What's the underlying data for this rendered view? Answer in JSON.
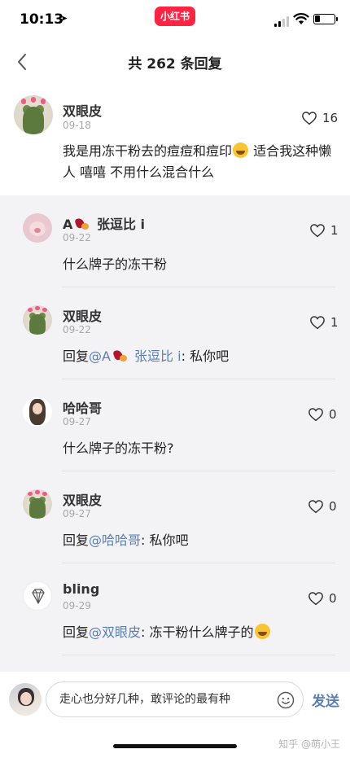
{
  "status_bar": {
    "time": "10:13",
    "location_icon": "location-arrow-icon",
    "app_badge": "小红书",
    "signal_icon": "cellular-signal-icon",
    "wifi_icon": "wifi-icon",
    "battery_icon": "battery-icon"
  },
  "nav": {
    "back_icon": "chevron-left-icon",
    "title": "共 262 条回复"
  },
  "main_comment": {
    "username": "双眼皮",
    "date": "09-18",
    "likes": "16",
    "text_part1": "我是用冻干粉去的痘痘和痘印",
    "emoji": "laughing-tears-emoji",
    "text_part2": " 适合我这种懒人 嘻嘻 不用什么混合什么"
  },
  "replies": [
    {
      "username_prefix": "A",
      "username_suffix": " 张逗比 i",
      "date": "09-22",
      "likes": "1",
      "text": "什么牌子的冻干粉"
    },
    {
      "username": "双眼皮",
      "date": "09-22",
      "likes": "1",
      "reply_label": "回复",
      "mention_prefix": "@A",
      "mention_suffix": " 张逗比 i",
      "text": ": 私你吧"
    },
    {
      "username": "哈哈哥",
      "date": "09-27",
      "likes": "0",
      "text": "什么牌子的冻干粉?"
    },
    {
      "username": "双眼皮",
      "date": "09-27",
      "likes": "0",
      "reply_label": "回复",
      "mention": "@哈哈哥",
      "text": ": 私你吧"
    },
    {
      "username": "bling",
      "date": "09-29",
      "likes": "0",
      "reply_label": "回复",
      "mention": "@双眼皮",
      "text": ": 冻干粉什么牌子的",
      "emoji": "grinning-emoji"
    }
  ],
  "bottom": {
    "input_placeholder": "走心也分好几种，敢评论的最有种",
    "smile_icon": "smile-icon",
    "send_label": "发送",
    "watermark": "知乎 @萌小王"
  },
  "colors": {
    "brand_red": "#ff2442",
    "mention_blue": "#5b7fb3",
    "reply_bg": "#f3f3f5"
  }
}
